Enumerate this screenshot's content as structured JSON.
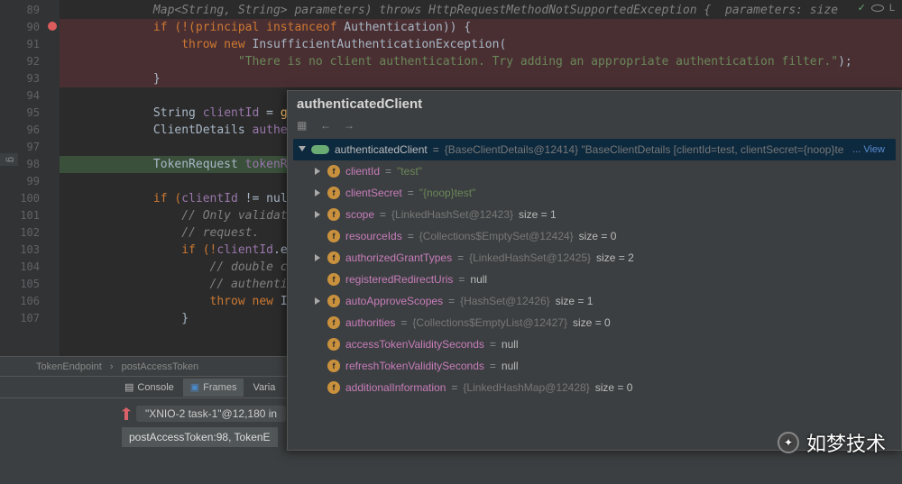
{
  "gutter": {
    "lines": [
      "89",
      "90",
      "91",
      "92",
      "93",
      "94",
      "95",
      "96",
      "97",
      "98",
      "99",
      "100",
      "101",
      "102",
      "103",
      "104",
      "105",
      "106",
      "107"
    ],
    "errLine": "90",
    "bpLine": "98"
  },
  "code": {
    "l89": "            Map<String, String> parameters) throws HttpRequestMethodNotSupportedException {  parameters: size ",
    "l90_pre": "            if (!(principal ",
    "l90_kw": "instanceof",
    "l90_post": " Authentication)) {",
    "l91_pre": "                throw new ",
    "l91_cls": "InsufficientAuthenticationException",
    "l91_post": "(",
    "l92_str": "                        \"There is no client authentication. Try adding an appropriate authentication filter.\"",
    "l92_post": ");",
    "l93": "            }",
    "l95_pre": "            String ",
    "l95_var": "clientId",
    "l95_mid": " = ",
    "l95_fn": "get",
    "l96_pre": "            ClientDetails ",
    "l96_var": "authent",
    "l98_pre": "            TokenRequest ",
    "l98_var": "tokenReq",
    "l100_pre": "            if (",
    "l100_var": "clientId",
    "l100_post": " != null",
    "l101": "                // Only validate",
    "l102": "                // request.",
    "l103_pre": "                if (!",
    "l103_var": "clientId",
    "l103_fn": ".equ",
    "l104": "                    // double che",
    "l105": "                    // authentica",
    "l106_pre": "                    throw new ",
    "l106_cls": "Inv",
    "l107": "                }"
  },
  "breadcrumbs": {
    "a": "TokenEndpoint",
    "b": "postAccessToken"
  },
  "debug": {
    "tab_console": "Console",
    "tab_frames": "Frames",
    "tab_vars": "Varia",
    "thread": "\"XNIO-2 task-1\"@12,180 in",
    "stack": "postAccessToken:98, TokenE"
  },
  "popup": {
    "title": "authenticatedClient",
    "root_name": "authenticatedClient",
    "root_val": "{BaseClientDetails@12414} \"BaseClientDetails [clientId=test, clientSecret={noop}te",
    "view": "... View",
    "fields": [
      {
        "arrow": "closed",
        "name": "clientId",
        "sep": " = ",
        "val": "\"test\"",
        "vtype": "str"
      },
      {
        "arrow": "closed",
        "name": "clientSecret",
        "sep": " = ",
        "val": "\"{noop}test\"",
        "vtype": "str"
      },
      {
        "arrow": "closed",
        "name": "scope",
        "sep": " = ",
        "obj": "{LinkedHashSet@12423}",
        "tail": "  size = 1"
      },
      {
        "arrow": "none",
        "name": "resourceIds",
        "sep": " = ",
        "obj": "{Collections$EmptySet@12424}",
        "tail": "  size = 0"
      },
      {
        "arrow": "closed",
        "name": "authorizedGrantTypes",
        "sep": " = ",
        "obj": "{LinkedHashSet@12425}",
        "tail": "  size = 2"
      },
      {
        "arrow": "none",
        "name": "registeredRedirectUris",
        "sep": " = ",
        "val": "null",
        "vtype": "plain"
      },
      {
        "arrow": "closed",
        "name": "autoApproveScopes",
        "sep": " = ",
        "obj": "{HashSet@12426}",
        "tail": "  size = 1"
      },
      {
        "arrow": "none",
        "name": "authorities",
        "sep": " = ",
        "obj": "{Collections$EmptyList@12427}",
        "tail": "  size = 0"
      },
      {
        "arrow": "none",
        "name": "accessTokenValiditySeconds",
        "sep": " = ",
        "val": "null",
        "vtype": "plain"
      },
      {
        "arrow": "none",
        "name": "refreshTokenValiditySeconds",
        "sep": " = ",
        "val": "null",
        "vtype": "plain"
      },
      {
        "arrow": "none",
        "name": "additionalInformation",
        "sep": " = ",
        "obj": "{LinkedHashMap@12428}",
        "tail": "  size = 0"
      }
    ]
  },
  "watermark": "如梦技术",
  "side": "g"
}
